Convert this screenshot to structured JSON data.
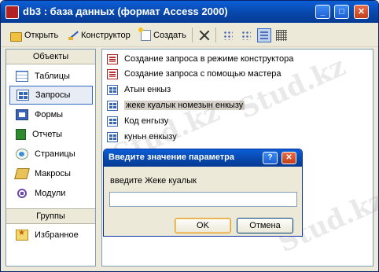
{
  "window": {
    "title": "db3 : база данных (формат Access 2000)",
    "controls": {
      "minimize": "_",
      "maximize": "□",
      "close": "✕"
    }
  },
  "toolbar": {
    "open": "Открыть",
    "design": "Конструктор",
    "create": "Создать",
    "icons": [
      "open-icon",
      "design-icon",
      "create-icon",
      "delete-icon",
      "large-icons-view",
      "small-icons-view",
      "list-view",
      "details-view"
    ]
  },
  "sidebar": {
    "objects_header": "Объекты",
    "items": [
      {
        "label": "Таблицы",
        "icon": "table-icon"
      },
      {
        "label": "Запросы",
        "icon": "query-icon",
        "selected": true
      },
      {
        "label": "Формы",
        "icon": "form-icon"
      },
      {
        "label": "Отчеты",
        "icon": "report-icon"
      },
      {
        "label": "Страницы",
        "icon": "page-icon"
      },
      {
        "label": "Макросы",
        "icon": "macro-icon"
      },
      {
        "label": "Модули",
        "icon": "module-icon"
      }
    ],
    "groups_header": "Группы",
    "groups": [
      {
        "label": "Избранное",
        "icon": "favorites-icon"
      }
    ]
  },
  "list": {
    "items": [
      {
        "label": "Создание запроса в режиме конструктора",
        "icon": "wizard-icon"
      },
      {
        "label": "Создание запроса с помощью мастера",
        "icon": "wizard-icon"
      },
      {
        "label": "Атын енкыз",
        "icon": "query-icon"
      },
      {
        "label": "жеке куалык номезын енкызу",
        "icon": "query-icon",
        "selected": true
      },
      {
        "label": "Код енгызу",
        "icon": "query-icon"
      },
      {
        "label": "куньн енкызу",
        "icon": "query-icon"
      }
    ]
  },
  "dialog": {
    "title": "Введите значение параметра",
    "help": "?",
    "close": "✕",
    "prompt": "введите Жеке куалык",
    "input_value": "",
    "ok": "OK",
    "cancel": "Отмена"
  },
  "watermark": "Stud.kz"
}
